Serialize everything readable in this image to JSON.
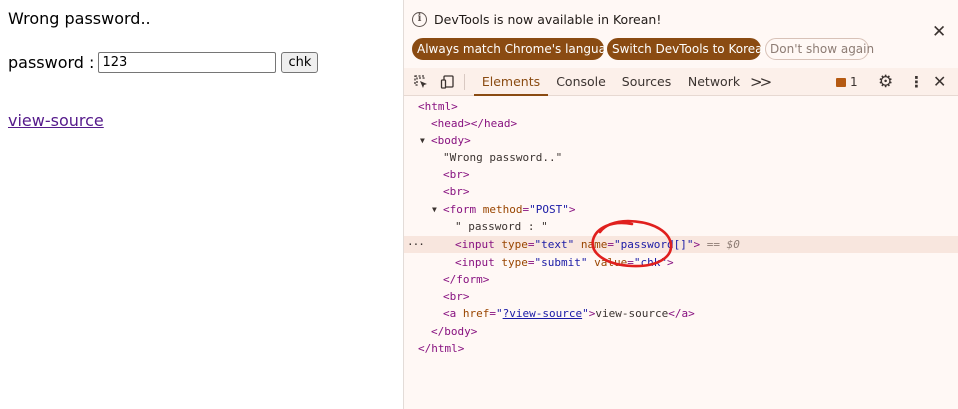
{
  "page": {
    "message": "Wrong password..",
    "password_label": "password :",
    "password_value": "123",
    "submit_label": "chk",
    "link_text": "view-source"
  },
  "infobar": {
    "message": "DevTools is now available in Korean!",
    "btn_match": "Always match Chrome's language",
    "btn_switch": "Switch DevTools to Korean",
    "btn_dont": "Don't show again"
  },
  "tabs": {
    "elements": "Elements",
    "console": "Console",
    "sources": "Sources",
    "network": "Network",
    "issues_count": "1"
  },
  "dom": {
    "html_open": "<html>",
    "head": "<head></head>",
    "body_open": "<body>",
    "text_node": "\"Wrong password..\"",
    "br": "<br>",
    "form_tag": "<form ",
    "form_attr": "method",
    "form_val": "\"POST\"",
    "form_close_bracket": ">",
    "pw_text": "\" password : \"",
    "input_open": "<input ",
    "type_attr": "type",
    "text_val": "\"text\"",
    "name_attr": "name",
    "name_val": "\"password[]\"",
    "tag_end": ">",
    "selected_ref": "== $0",
    "submit_val": "\"submit\"",
    "value_attr": "value",
    "chk_val": "\"chk\"",
    "form_end": "</form>",
    "a_open": "<a ",
    "href_attr": "href",
    "href_val": "?view-source",
    "a_text": "view-source",
    "a_end": "</a>",
    "body_end": "</body>",
    "html_end": "</html>"
  },
  "colors": {
    "accent": "#8a4b12",
    "annotation_circle": "#e0201e",
    "link_visited": "#551a8b"
  }
}
